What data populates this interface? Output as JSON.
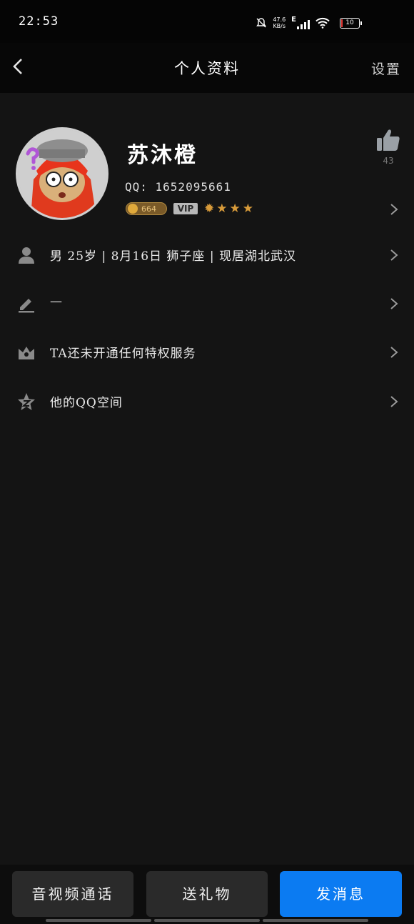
{
  "status_bar": {
    "time": "22:53",
    "speed_value": "47.6",
    "speed_unit": "KB/s",
    "network": "E",
    "battery": "10"
  },
  "header": {
    "title": "个人资料",
    "settings_label": "设置"
  },
  "profile": {
    "name": "苏沐橙",
    "qq": "QQ: 1652095661",
    "coin_value": "664",
    "vip_label": "VIP",
    "likes": "43"
  },
  "rows": [
    {
      "text": "男  25岁 | 8月16日  狮子座 | 现居湖北武汉",
      "icon": "person-icon"
    },
    {
      "text": "—",
      "icon": "edit-icon"
    },
    {
      "text": "TA还未开通任何特权服务",
      "icon": "crown-icon"
    },
    {
      "text": "他的QQ空间",
      "icon": "qzone-star-icon"
    }
  ],
  "bottom_bar": {
    "call_label": "音视频通话",
    "gift_label": "送礼物",
    "message_label": "发消息"
  },
  "colors": {
    "background": "#141414",
    "primary_button": "#0b7bf2",
    "level_star": "#d89b3a"
  }
}
